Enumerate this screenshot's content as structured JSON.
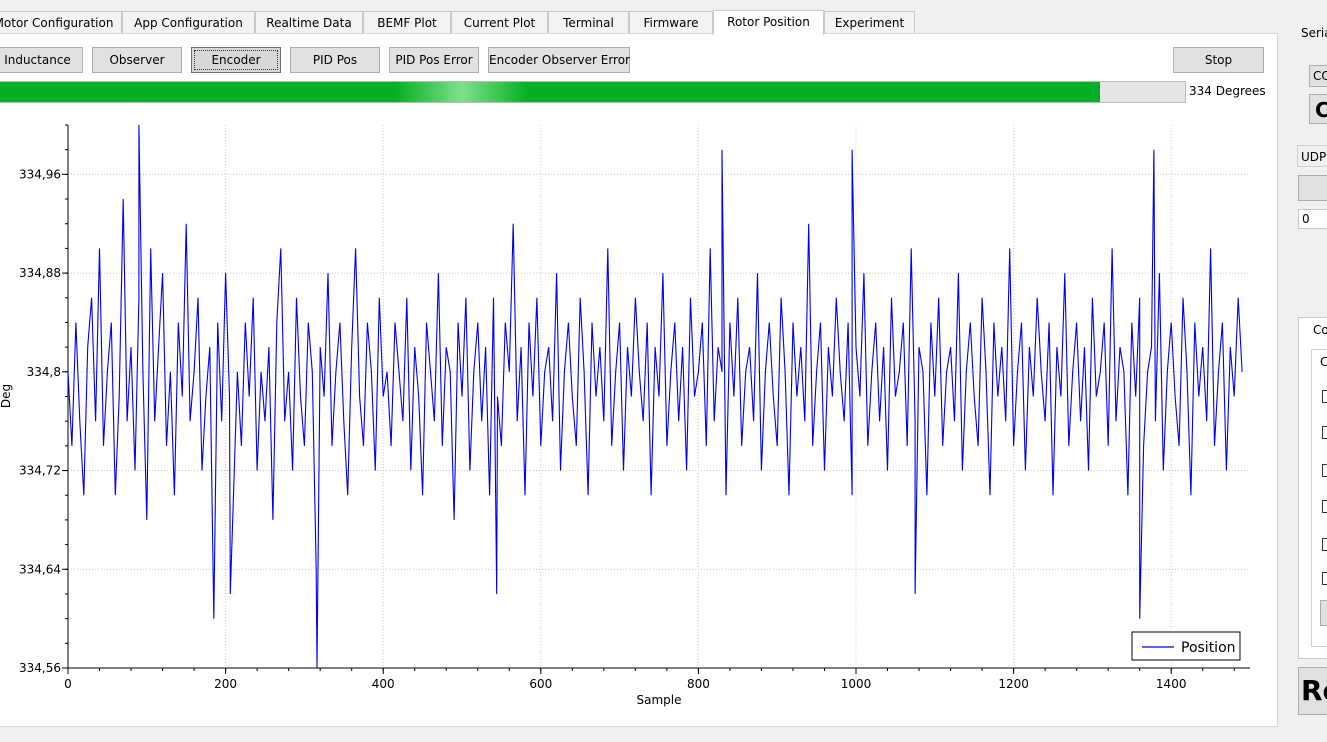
{
  "tabs": [
    {
      "label": "Motor Configuration",
      "left": -15,
      "width": 137
    },
    {
      "label": "App Configuration",
      "left": 122,
      "width": 133
    },
    {
      "label": "Realtime Data",
      "left": 255,
      "width": 108
    },
    {
      "label": "BEMF Plot",
      "left": 363,
      "width": 88
    },
    {
      "label": "Current Plot",
      "left": 451,
      "width": 97
    },
    {
      "label": "Terminal",
      "left": 548,
      "width": 81
    },
    {
      "label": "Firmware",
      "left": 629,
      "width": 84
    },
    {
      "label": "Rotor Position",
      "left": 713,
      "width": 111
    },
    {
      "label": "Experiment",
      "left": 824,
      "width": 91
    }
  ],
  "active_tab": "Rotor Position",
  "mode_buttons": [
    {
      "label": "Inductance"
    },
    {
      "label": "Observer"
    },
    {
      "label": "Encoder"
    },
    {
      "label": "PID Pos"
    },
    {
      "label": "PID Pos Error"
    },
    {
      "label": "Encoder Observer Error"
    }
  ],
  "selected_mode": "Encoder",
  "stop_label": "Stop",
  "position": {
    "label": "334 Degrees",
    "fraction": 0.928
  },
  "colors": {
    "progress": "#06b025",
    "series": "#0000ee"
  },
  "side_panel": {
    "serial_label": "Seria",
    "com_label": "CO",
    "connect_partial": "C",
    "udp_label": "UDP",
    "value_field": "0",
    "group_title": "Co",
    "group_subtitle": "C",
    "bottom_button_partial": "Re"
  },
  "chart_data": {
    "type": "line",
    "xlabel": "Sample",
    "ylabel": "Deg",
    "xlim": [
      0,
      1500
    ],
    "ylim": [
      334.56,
      335.0
    ],
    "x_ticks": [
      0,
      200,
      400,
      600,
      800,
      1000,
      1200,
      1400
    ],
    "y_ticks": [
      334.56,
      334.64,
      334.72,
      334.8,
      334.88,
      334.96
    ],
    "y_tick_labels": [
      "334,56",
      "334,64",
      "334,72",
      "334,8",
      "334,88",
      "334,96"
    ],
    "grid": true,
    "legend": "bottom-right",
    "series": [
      {
        "name": "Position",
        "x_start": 0,
        "x_step": 5,
        "values": [
          334.8,
          334.74,
          334.84,
          334.76,
          334.7,
          334.82,
          334.86,
          334.76,
          334.9,
          334.74,
          334.8,
          334.84,
          334.7,
          334.78,
          334.94,
          334.76,
          334.82,
          334.72,
          334.86,
          334.8,
          334.68,
          334.9,
          334.76,
          334.82,
          334.88,
          334.74,
          334.8,
          334.7,
          334.84,
          334.78,
          334.92,
          334.76,
          334.8,
          334.86,
          334.72,
          334.78,
          334.82,
          334.6,
          334.84,
          334.76,
          334.88,
          334.78,
          334.7,
          334.8,
          334.74,
          334.84,
          334.78,
          334.86,
          334.72,
          334.8,
          334.76,
          334.82,
          334.68,
          334.84,
          334.9,
          334.76,
          334.8,
          334.72,
          334.86,
          334.78,
          334.74,
          334.84,
          334.8,
          334.64,
          334.82,
          334.78,
          334.88,
          334.74,
          334.8,
          334.84,
          334.76,
          334.7,
          334.82,
          334.9,
          334.78,
          334.74,
          334.84,
          334.8,
          334.72,
          334.86,
          334.78,
          334.8,
          334.74,
          334.84,
          334.8,
          334.76,
          334.86,
          334.72,
          334.82,
          334.78,
          334.7,
          334.84,
          334.8,
          334.76,
          334.88,
          334.74,
          334.82,
          334.8,
          334.68,
          334.84,
          334.78,
          334.86,
          334.72,
          334.8,
          334.84,
          334.76,
          334.82,
          334.7,
          334.86,
          334.78,
          334.74,
          334.84,
          334.8,
          334.92,
          334.76,
          334.82,
          334.7,
          334.84,
          334.78,
          334.86,
          334.74,
          334.8,
          334.82,
          334.76,
          334.88,
          334.72,
          334.8,
          334.84,
          334.78,
          334.74,
          334.86,
          334.8,
          334.7,
          334.84,
          334.78,
          334.82,
          334.76,
          334.9,
          334.74,
          334.8,
          334.84,
          334.72,
          334.82,
          334.78,
          334.86,
          334.8,
          334.76,
          334.84,
          334.7,
          334.82,
          334.78,
          334.88,
          334.74,
          334.8,
          334.84,
          334.76,
          334.82,
          334.72,
          334.86,
          334.78,
          334.8,
          334.84,
          334.74,
          334.9,
          334.76,
          334.82,
          334.8,
          334.7,
          334.84,
          334.78,
          334.86,
          334.74,
          334.8,
          334.82,
          334.76,
          334.88,
          334.72,
          334.8,
          334.84,
          334.78,
          334.74,
          334.86,
          334.8,
          334.7,
          334.84,
          334.78,
          334.82,
          334.76,
          334.92,
          334.74,
          334.8,
          334.84,
          334.72,
          334.82,
          334.78,
          334.86,
          334.8,
          334.76,
          334.84,
          334.7,
          334.82,
          334.78,
          334.88,
          334.74,
          334.8,
          334.84,
          334.76,
          334.82,
          334.72,
          334.86,
          334.78,
          334.8,
          334.84,
          334.74,
          334.9,
          334.76,
          334.82,
          334.8,
          334.7,
          334.84,
          334.78,
          334.86,
          334.74,
          334.8,
          334.82,
          334.76,
          334.88,
          334.72,
          334.8,
          334.84,
          334.78,
          334.74,
          334.86,
          334.8,
          334.7,
          334.84,
          334.78,
          334.82,
          334.76,
          334.9,
          334.74,
          334.8,
          334.84,
          334.72,
          334.82,
          334.78,
          334.86,
          334.8,
          334.76,
          334.84,
          334.7,
          334.82,
          334.78,
          334.88,
          334.74,
          334.8,
          334.84,
          334.76,
          334.82,
          334.72,
          334.86,
          334.78,
          334.8,
          334.84,
          334.74,
          334.9,
          334.76,
          334.82,
          334.8,
          334.7,
          334.84,
          334.78,
          334.86,
          334.74,
          334.8,
          334.82,
          334.76,
          334.88,
          334.72,
          334.8,
          334.84,
          334.78,
          334.74,
          334.86,
          334.8,
          334.7,
          334.84,
          334.78,
          334.82,
          334.76,
          334.9,
          334.74,
          334.8,
          334.84,
          334.72,
          334.82,
          334.78,
          334.86,
          334.8
        ]
      }
    ],
    "annotations_samples": [
      {
        "x": 90,
        "y": 335.0
      },
      {
        "x": 316,
        "y": 334.56
      },
      {
        "x": 206,
        "y": 334.62
      },
      {
        "x": 544,
        "y": 334.62
      },
      {
        "x": 1075,
        "y": 334.62
      },
      {
        "x": 1360,
        "y": 334.6
      },
      {
        "x": 830,
        "y": 334.98
      },
      {
        "x": 995,
        "y": 334.98
      },
      {
        "x": 1378,
        "y": 334.98
      }
    ]
  }
}
